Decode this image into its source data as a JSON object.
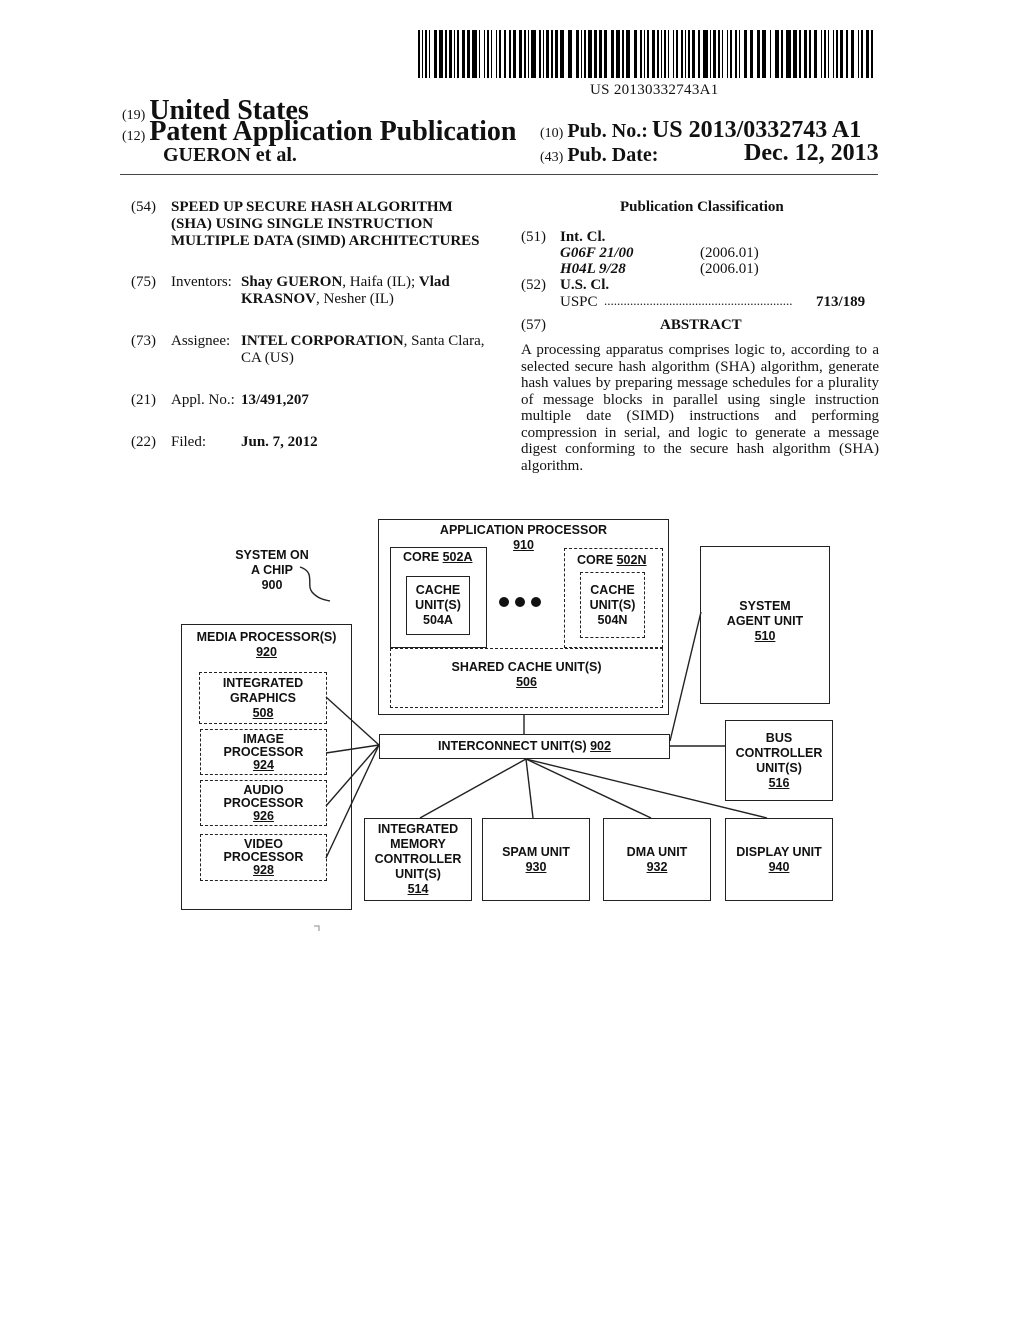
{
  "header": {
    "barcode_number": "US 20130332743A1",
    "country_code": "(19)",
    "country": "United States",
    "doc_type_code": "(12)",
    "doc_type": "Patent Application Publication",
    "applicant": "GUERON et al.",
    "pub_no_code": "(10)",
    "pub_no_label": "Pub. No.:",
    "pub_no": "US 2013/0332743 A1",
    "pub_date_code": "(43)",
    "pub_date_label": "Pub. Date:",
    "pub_date": "Dec. 12, 2013"
  },
  "biblio": {
    "title_code": "(54)",
    "title_lines": [
      "SPEED UP SECURE HASH ALGORITHM",
      "(SHA) USING SINGLE INSTRUCTION",
      "MULTIPLE DATA (SIMD) ARCHITECTURES"
    ],
    "inventors_code": "(75)",
    "inventors_label": "Inventors:",
    "inventor1_name": "Shay GUERON",
    "inventor1_loc": ", Haifa (IL); ",
    "inventor2_first": "Vlad",
    "inventor2_last": "KRASNOV",
    "inventor2_loc": ", Nesher (IL)",
    "assignee_code": "(73)",
    "assignee_label": "Assignee:",
    "assignee_name": "INTEL CORPORATION",
    "assignee_loc1": ", Santa Clara,",
    "assignee_loc2": "CA (US)",
    "appl_code": "(21)",
    "appl_label": "Appl. No.:",
    "appl_no": "13/491,207",
    "filed_code": "(22)",
    "filed_label": "Filed:",
    "filed_date": "Jun. 7, 2012"
  },
  "classification": {
    "heading": "Publication Classification",
    "int_cl_code": "(51)",
    "int_cl_label": "Int. Cl.",
    "int_cl": [
      {
        "code": "G06F 21/00",
        "version": "(2006.01)"
      },
      {
        "code": "H04L 9/28",
        "version": "(2006.01)"
      }
    ],
    "us_cl_code": "(52)",
    "us_cl_label": "U.S. Cl.",
    "uspc_label": "USPC",
    "uspc_dots": "..........................................................",
    "uspc_value": "713/189"
  },
  "abstract": {
    "code": "(57)",
    "heading": "ABSTRACT",
    "text": "A processing apparatus comprises logic to, according to a selected secure hash algorithm (SHA) algorithm, generate hash values by preparing message schedules for a plurality of message blocks in parallel using single instruction multiple date (SIMD) instructions and performing compression in serial, and logic to generate a message digest conforming to the secure hash algorithm (SHA) algorithm."
  },
  "diagram": {
    "soc_label": [
      "SYSTEM ON",
      "A CHIP",
      "900"
    ],
    "app_processor": {
      "title": "APPLICATION PROCESSOR",
      "ref": "910"
    },
    "core_a": {
      "title": "CORE ",
      "ref": "502A"
    },
    "cache_a": [
      "CACHE",
      "UNIT(S)",
      "504A"
    ],
    "core_n": {
      "title": "CORE ",
      "ref": "502N"
    },
    "cache_n": [
      "CACHE",
      "UNIT(S)",
      "504N"
    ],
    "shared_cache": {
      "title": "SHARED CACHE UNIT(S)",
      "ref": "506"
    },
    "system_agent": {
      "lines": [
        "SYSTEM",
        "AGENT UNIT"
      ],
      "ref": "510"
    },
    "media_processor": {
      "title": "MEDIA PROCESSOR(S)",
      "ref": "920"
    },
    "integrated_graphics": {
      "lines": [
        "INTEGRATED",
        "GRAPHICS"
      ],
      "ref": "508"
    },
    "image_processor": {
      "lines": [
        "IMAGE",
        "PROCESSOR"
      ],
      "ref": "924"
    },
    "audio_processor": {
      "lines": [
        "AUDIO",
        "PROCESSOR"
      ],
      "ref": "926"
    },
    "video_processor": {
      "lines": [
        "VIDEO",
        "PROCESSOR"
      ],
      "ref": "928"
    },
    "interconnect": {
      "title": "INTERCONNECT UNIT(S) ",
      "ref": "902"
    },
    "bus_controller": {
      "lines": [
        "BUS",
        "CONTROLLER",
        "UNIT(S)"
      ],
      "ref": "516"
    },
    "memory_controller": {
      "lines": [
        "INTEGRATED",
        "MEMORY",
        "CONTROLLER",
        "UNIT(S)"
      ],
      "ref": "514"
    },
    "spam_unit": {
      "title": "SPAM UNIT",
      "ref": "930"
    },
    "dma_unit": {
      "title": "DMA UNIT",
      "ref": "932"
    },
    "display_unit": {
      "title": "DISPLAY UNIT",
      "ref": "940"
    }
  }
}
